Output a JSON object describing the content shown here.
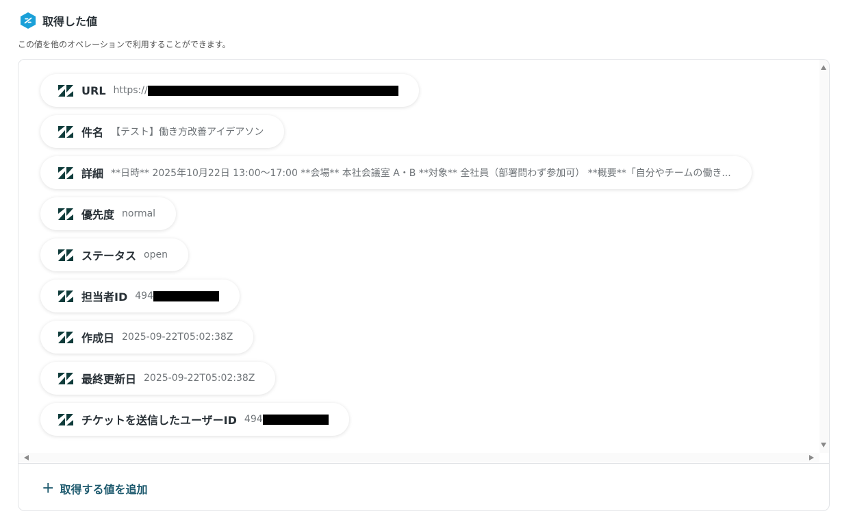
{
  "header": {
    "title": "取得した値",
    "subtitle": "この値を他のオペレーションで利用することができます。"
  },
  "fields": [
    {
      "label": "URL",
      "value": "https://",
      "redacted": true
    },
    {
      "label": "件名",
      "value": "【テスト】働き方改善アイデアソン"
    },
    {
      "label": "詳細",
      "value": "**日時** 2025年10月22日 13:00〜17:00 **会場** 本社会議室 A・B **対象** 全社員（部署問わず参加可） **概要**「自分やチームの働き..."
    },
    {
      "label": "優先度",
      "value": "normal"
    },
    {
      "label": "ステータス",
      "value": "open"
    },
    {
      "label": "担当者ID",
      "value": "494",
      "redacted": true
    },
    {
      "label": "作成日",
      "value": "2025-09-22T05:02:38Z"
    },
    {
      "label": "最終更新日",
      "value": "2025-09-22T05:02:38Z"
    },
    {
      "label": "チケットを送信したユーザーID",
      "value": "494",
      "redacted": true
    }
  ],
  "footer": {
    "add_label": "取得する値を追加"
  },
  "colors": {
    "accent": "#1e5a6e",
    "icon_hex": "#1aa0d8"
  }
}
